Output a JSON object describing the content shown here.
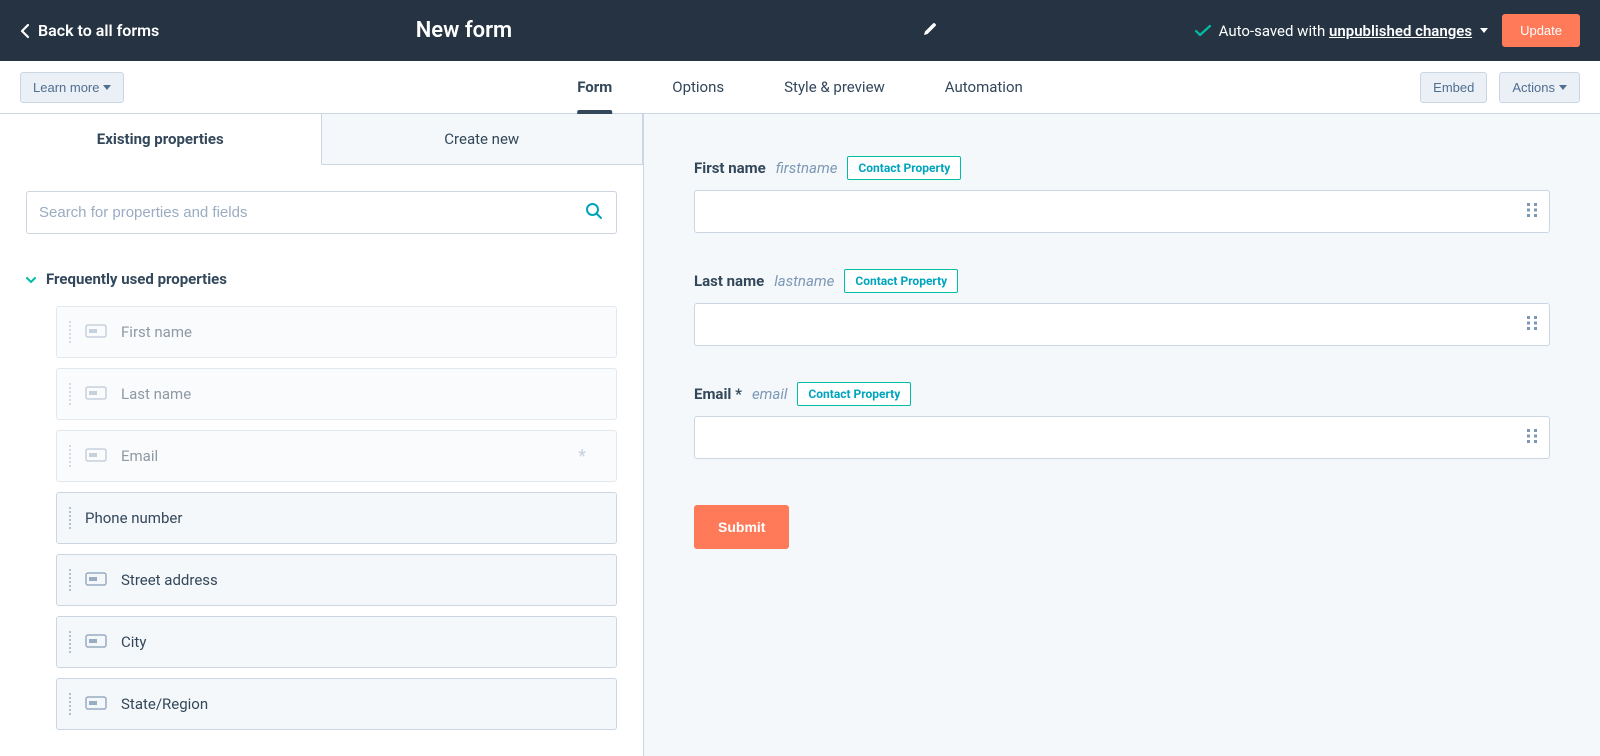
{
  "topbar": {
    "back_label": "Back to all forms",
    "form_title": "New form",
    "autosave_prefix": "Auto-saved with ",
    "autosave_link": "unpublished changes",
    "update_label": "Update"
  },
  "secondbar": {
    "learn_more": "Learn more",
    "tabs": [
      {
        "label": "Form",
        "active": true
      },
      {
        "label": "Options",
        "active": false
      },
      {
        "label": "Style & preview",
        "active": false
      },
      {
        "label": "Automation",
        "active": false
      }
    ],
    "embed": "Embed",
    "actions": "Actions"
  },
  "sidebar": {
    "tabs": [
      {
        "label": "Existing properties",
        "active": true
      },
      {
        "label": "Create new",
        "active": false
      }
    ],
    "search_placeholder": "Search for properties and fields",
    "frequently_used_label": "Frequently used properties",
    "properties": [
      {
        "label": "First name",
        "used": true,
        "required": false
      },
      {
        "label": "Last name",
        "used": true,
        "required": false
      },
      {
        "label": "Email",
        "used": true,
        "required": true
      },
      {
        "label": "Phone number",
        "used": false,
        "required": false
      },
      {
        "label": "Street address",
        "used": false,
        "required": false
      },
      {
        "label": "City",
        "used": false,
        "required": false
      },
      {
        "label": "State/Region",
        "used": false,
        "required": false
      }
    ]
  },
  "canvas": {
    "fields": [
      {
        "title": "First name",
        "internal": "firstname",
        "badge": "Contact Property",
        "required": false,
        "value": ""
      },
      {
        "title": "Last name",
        "internal": "lastname",
        "badge": "Contact Property",
        "required": false,
        "value": ""
      },
      {
        "title": "Email",
        "internal": "email",
        "badge": "Contact Property",
        "required": true,
        "value": ""
      }
    ],
    "submit_label": "Submit"
  }
}
